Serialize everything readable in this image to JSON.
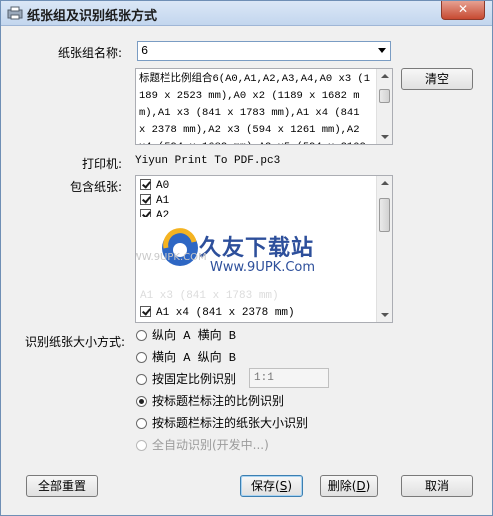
{
  "window": {
    "title": "纸张组及识别纸张方式",
    "close_label": "✕"
  },
  "form": {
    "group_name_label": "纸张组名称:",
    "group_name_value": "6",
    "clear_button": "清空",
    "description": "标题栏比例组合6(A0,A1,A2,A3,A4,A0 x3 (1189 x 2523 mm),A0 x2 (1189 x 1682 mm),A1 x3 (841 x 1783 mm),A1 x4 (841 x 2378 mm),A2 x3 (594 x 1261 mm),A2 x4 (594 x 1682 mm),A2 x5 (594 x 2102",
    "printer_label": "打印机:",
    "printer_value": "Yiyun Print To PDF.pc3",
    "papers_label": "包含纸张:",
    "papers": [
      "A0",
      "A1",
      "A2"
    ],
    "papers_last": "A1 x4 (841 x 2378 mm)",
    "papers_ghost": "A1 x3 (841 x 1783 mm)"
  },
  "watermark": {
    "cn": "久友下载站",
    "en": "Www.9UPK.Com",
    "ghost": "WWW.9UPK.COM"
  },
  "recognize": {
    "label": "识别纸张大小方式:",
    "options": [
      "纵向 A 横向 B",
      "横向 A 纵向 B",
      "按固定比例识别",
      "按标题栏标注的比例识别",
      "按标题栏标注的纸张大小识别",
      "全自动识别(开发中...)"
    ],
    "ratio_value": "1:1"
  },
  "buttons": {
    "reset": "全部重置",
    "save": "保存(",
    "save_key": "S",
    "delete": "删除(",
    "delete_key": "D",
    "cancel": "取消",
    "close_paren": ")"
  }
}
